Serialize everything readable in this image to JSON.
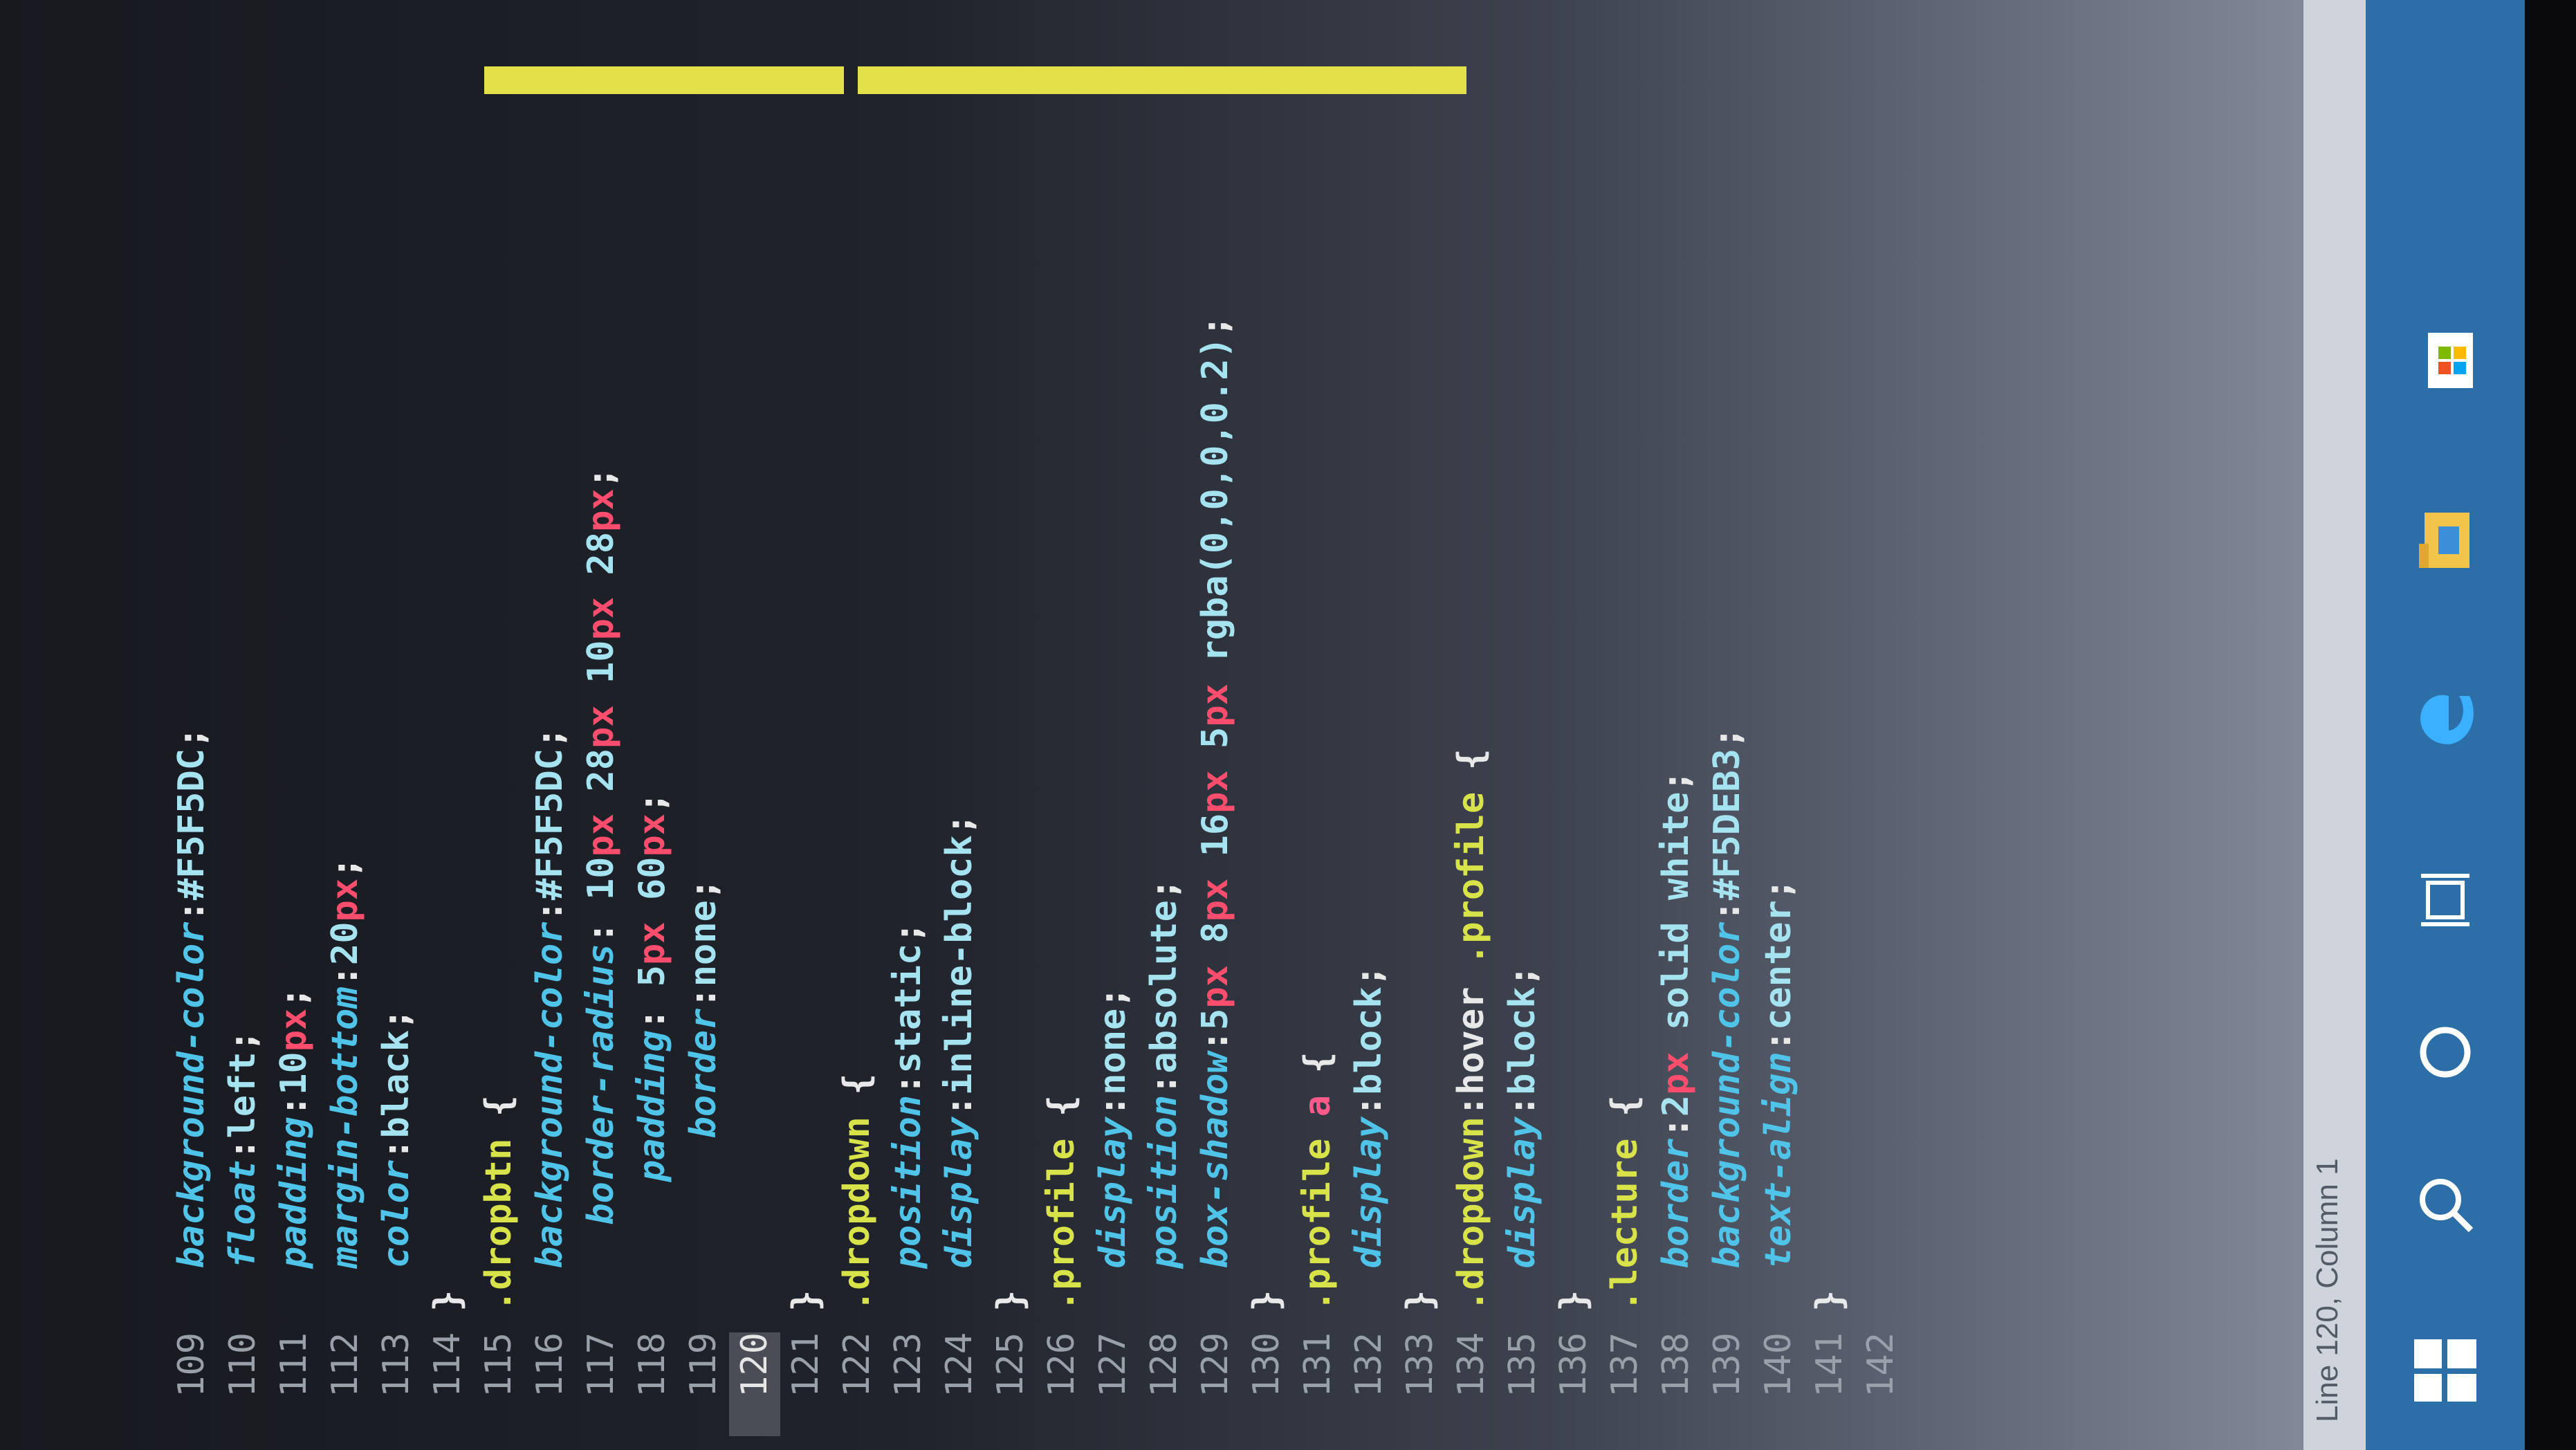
{
  "editor": {
    "lines": [
      {
        "n": "109",
        "tokens": [
          {
            "t": "  ",
            "c": "plain"
          },
          {
            "t": "background-color",
            "c": "prop"
          },
          {
            "t": ":",
            "c": "pun"
          },
          {
            "t": "#F5F5DC",
            "c": "val"
          },
          {
            "t": ";",
            "c": "pun"
          }
        ]
      },
      {
        "n": "110",
        "tokens": [
          {
            "t": "  ",
            "c": "plain"
          },
          {
            "t": "float",
            "c": "prop"
          },
          {
            "t": ":",
            "c": "pun"
          },
          {
            "t": "left",
            "c": "val"
          },
          {
            "t": ";",
            "c": "pun"
          }
        ]
      },
      {
        "n": "111",
        "tokens": [
          {
            "t": "  ",
            "c": "plain"
          },
          {
            "t": "padding",
            "c": "prop"
          },
          {
            "t": ":",
            "c": "pun"
          },
          {
            "t": "10",
            "c": "val"
          },
          {
            "t": "px",
            "c": "unit"
          },
          {
            "t": ";",
            "c": "pun"
          }
        ]
      },
      {
        "n": "112",
        "tokens": [
          {
            "t": "  ",
            "c": "plain"
          },
          {
            "t": "margin-bottom",
            "c": "prop"
          },
          {
            "t": ":",
            "c": "pun"
          },
          {
            "t": "20",
            "c": "val"
          },
          {
            "t": "px",
            "c": "unit"
          },
          {
            "t": ";",
            "c": "pun"
          }
        ]
      },
      {
        "n": "113",
        "tokens": [
          {
            "t": "  ",
            "c": "plain"
          },
          {
            "t": "color",
            "c": "prop"
          },
          {
            "t": ":",
            "c": "pun"
          },
          {
            "t": "black",
            "c": "val"
          },
          {
            "t": ";",
            "c": "pun"
          }
        ]
      },
      {
        "n": "114",
        "tokens": [
          {
            "t": "}",
            "c": "pun"
          }
        ]
      },
      {
        "n": "115",
        "tokens": [
          {
            "t": ".dropbtn",
            "c": "sel"
          },
          {
            "t": " {",
            "c": "pun"
          }
        ]
      },
      {
        "n": "116",
        "tokens": [
          {
            "t": "  ",
            "c": "plain"
          },
          {
            "t": "background-color",
            "c": "prop"
          },
          {
            "t": ":",
            "c": "pun"
          },
          {
            "t": "#F5F5DC",
            "c": "val"
          },
          {
            "t": ";",
            "c": "pun"
          }
        ]
      },
      {
        "n": "117",
        "tokens": [
          {
            "t": "    ",
            "c": "plain"
          },
          {
            "t": "border-radius",
            "c": "prop"
          },
          {
            "t": ": ",
            "c": "pun"
          },
          {
            "t": "10",
            "c": "val"
          },
          {
            "t": "px",
            "c": "unit"
          },
          {
            "t": " 28",
            "c": "val"
          },
          {
            "t": "px",
            "c": "unit"
          },
          {
            "t": " 10",
            "c": "val"
          },
          {
            "t": "px",
            "c": "unit"
          },
          {
            "t": " 28",
            "c": "val"
          },
          {
            "t": "px",
            "c": "unit"
          },
          {
            "t": ";",
            "c": "pun"
          }
        ]
      },
      {
        "n": "118",
        "tokens": [
          {
            "t": "      ",
            "c": "plain"
          },
          {
            "t": "padding",
            "c": "prop"
          },
          {
            "t": ": ",
            "c": "pun"
          },
          {
            "t": "5",
            "c": "val"
          },
          {
            "t": "px",
            "c": "unit"
          },
          {
            "t": " 60",
            "c": "val"
          },
          {
            "t": "px",
            "c": "unit"
          },
          {
            "t": ";",
            "c": "pun"
          }
        ]
      },
      {
        "n": "119",
        "tokens": [
          {
            "t": "        ",
            "c": "plain"
          },
          {
            "t": "border",
            "c": "prop"
          },
          {
            "t": ":",
            "c": "pun"
          },
          {
            "t": "none",
            "c": "val"
          },
          {
            "t": ";",
            "c": "pun"
          }
        ]
      },
      {
        "n": "120",
        "tokens": [
          {
            "t": "      ",
            "c": "plain"
          }
        ]
      },
      {
        "n": "121",
        "tokens": [
          {
            "t": "}",
            "c": "pun"
          }
        ]
      },
      {
        "n": "122",
        "tokens": [
          {
            "t": ".dropdown",
            "c": "sel"
          },
          {
            "t": " {",
            "c": "pun"
          }
        ]
      },
      {
        "n": "123",
        "tokens": [
          {
            "t": "  ",
            "c": "plain"
          },
          {
            "t": "position",
            "c": "prop"
          },
          {
            "t": ":",
            "c": "pun"
          },
          {
            "t": "static",
            "c": "val"
          },
          {
            "t": ";",
            "c": "pun"
          }
        ]
      },
      {
        "n": "124",
        "tokens": [
          {
            "t": "  ",
            "c": "plain"
          },
          {
            "t": "display",
            "c": "prop"
          },
          {
            "t": ":",
            "c": "pun"
          },
          {
            "t": "inline-block",
            "c": "val"
          },
          {
            "t": ";",
            "c": "pun"
          }
        ]
      },
      {
        "n": "125",
        "tokens": [
          {
            "t": "}",
            "c": "pun"
          }
        ]
      },
      {
        "n": "126",
        "tokens": [
          {
            "t": ".profile",
            "c": "sel"
          },
          {
            "t": " {",
            "c": "pun"
          }
        ]
      },
      {
        "n": "127",
        "tokens": [
          {
            "t": "  ",
            "c": "plain"
          },
          {
            "t": "display",
            "c": "prop"
          },
          {
            "t": ":",
            "c": "pun"
          },
          {
            "t": "none",
            "c": "val"
          },
          {
            "t": ";",
            "c": "pun"
          }
        ]
      },
      {
        "n": "128",
        "tokens": [
          {
            "t": "  ",
            "c": "plain"
          },
          {
            "t": "position",
            "c": "prop"
          },
          {
            "t": ":",
            "c": "pun"
          },
          {
            "t": "absolute",
            "c": "val"
          },
          {
            "t": ";",
            "c": "pun"
          }
        ]
      },
      {
        "n": "129",
        "tokens": [
          {
            "t": "  ",
            "c": "plain"
          },
          {
            "t": "box-shadow",
            "c": "prop"
          },
          {
            "t": ":",
            "c": "pun"
          },
          {
            "t": "5",
            "c": "val"
          },
          {
            "t": "px",
            "c": "unit"
          },
          {
            "t": " 8",
            "c": "val"
          },
          {
            "t": "px",
            "c": "unit"
          },
          {
            "t": " 16",
            "c": "val"
          },
          {
            "t": "px",
            "c": "unit"
          },
          {
            "t": " 5",
            "c": "val"
          },
          {
            "t": "px",
            "c": "unit"
          },
          {
            "t": " rgba(0,0,0,0.2)",
            "c": "val"
          },
          {
            "t": ";",
            "c": "pun"
          }
        ]
      },
      {
        "n": "130",
        "tokens": [
          {
            "t": "}",
            "c": "pun"
          }
        ]
      },
      {
        "n": "131",
        "tokens": [
          {
            "t": ".profile ",
            "c": "sel"
          },
          {
            "t": "a",
            "c": "kw"
          },
          {
            "t": " {",
            "c": "pun"
          }
        ]
      },
      {
        "n": "132",
        "tokens": [
          {
            "t": "  ",
            "c": "plain"
          },
          {
            "t": "display",
            "c": "prop"
          },
          {
            "t": ":",
            "c": "pun"
          },
          {
            "t": "block",
            "c": "val"
          },
          {
            "t": ";",
            "c": "pun"
          }
        ]
      },
      {
        "n": "133",
        "tokens": [
          {
            "t": "}",
            "c": "pun"
          }
        ]
      },
      {
        "n": "134",
        "tokens": [
          {
            "t": ".dropdown",
            "c": "sel"
          },
          {
            "t": ":hover",
            "c": "plain"
          },
          {
            "t": " .profile",
            "c": "sel"
          },
          {
            "t": " {",
            "c": "pun"
          }
        ]
      },
      {
        "n": "135",
        "tokens": [
          {
            "t": "  ",
            "c": "plain"
          },
          {
            "t": "display",
            "c": "prop"
          },
          {
            "t": ":",
            "c": "pun"
          },
          {
            "t": "block",
            "c": "val"
          },
          {
            "t": ";",
            "c": "pun"
          }
        ]
      },
      {
        "n": "136",
        "tokens": [
          {
            "t": "}",
            "c": "pun"
          }
        ]
      },
      {
        "n": "137",
        "tokens": [
          {
            "t": ".lecture",
            "c": "sel"
          },
          {
            "t": " {",
            "c": "pun"
          }
        ]
      },
      {
        "n": "138",
        "tokens": [
          {
            "t": "  ",
            "c": "plain"
          },
          {
            "t": "border",
            "c": "prop"
          },
          {
            "t": ":",
            "c": "pun"
          },
          {
            "t": "2",
            "c": "val"
          },
          {
            "t": "px",
            "c": "unit"
          },
          {
            "t": " solid white",
            "c": "val"
          },
          {
            "t": ";",
            "c": "pun"
          }
        ]
      },
      {
        "n": "139",
        "tokens": [
          {
            "t": "  ",
            "c": "plain"
          },
          {
            "t": "background-color",
            "c": "prop"
          },
          {
            "t": ":",
            "c": "pun"
          },
          {
            "t": "#F5DEB3",
            "c": "val"
          },
          {
            "t": ";",
            "c": "pun"
          }
        ]
      },
      {
        "n": "140",
        "tokens": [
          {
            "t": "  ",
            "c": "plain"
          },
          {
            "t": "text-align",
            "c": "prop"
          },
          {
            "t": ":",
            "c": "pun"
          },
          {
            "t": "center",
            "c": "val"
          },
          {
            "t": ";",
            "c": "pun"
          }
        ]
      },
      {
        "n": "141",
        "tokens": [
          {
            "t": "}",
            "c": "pun"
          }
        ]
      },
      {
        "n": "142",
        "tokens": []
      }
    ],
    "current_line": "120"
  },
  "statusbar": {
    "text": "Line 120, Column 1"
  },
  "taskbar": {
    "icons": [
      "windows-start-icon",
      "search-icon",
      "cortana-icon",
      "task-view-icon",
      "edge-icon",
      "file-explorer-icon",
      "store-icon"
    ]
  },
  "colors": {
    "selector": "#d8e34a",
    "property": "#4fc3e8",
    "value": "#a6e3f0",
    "unit": "#ff4d6d",
    "taskbar": "#2b6ea8"
  }
}
